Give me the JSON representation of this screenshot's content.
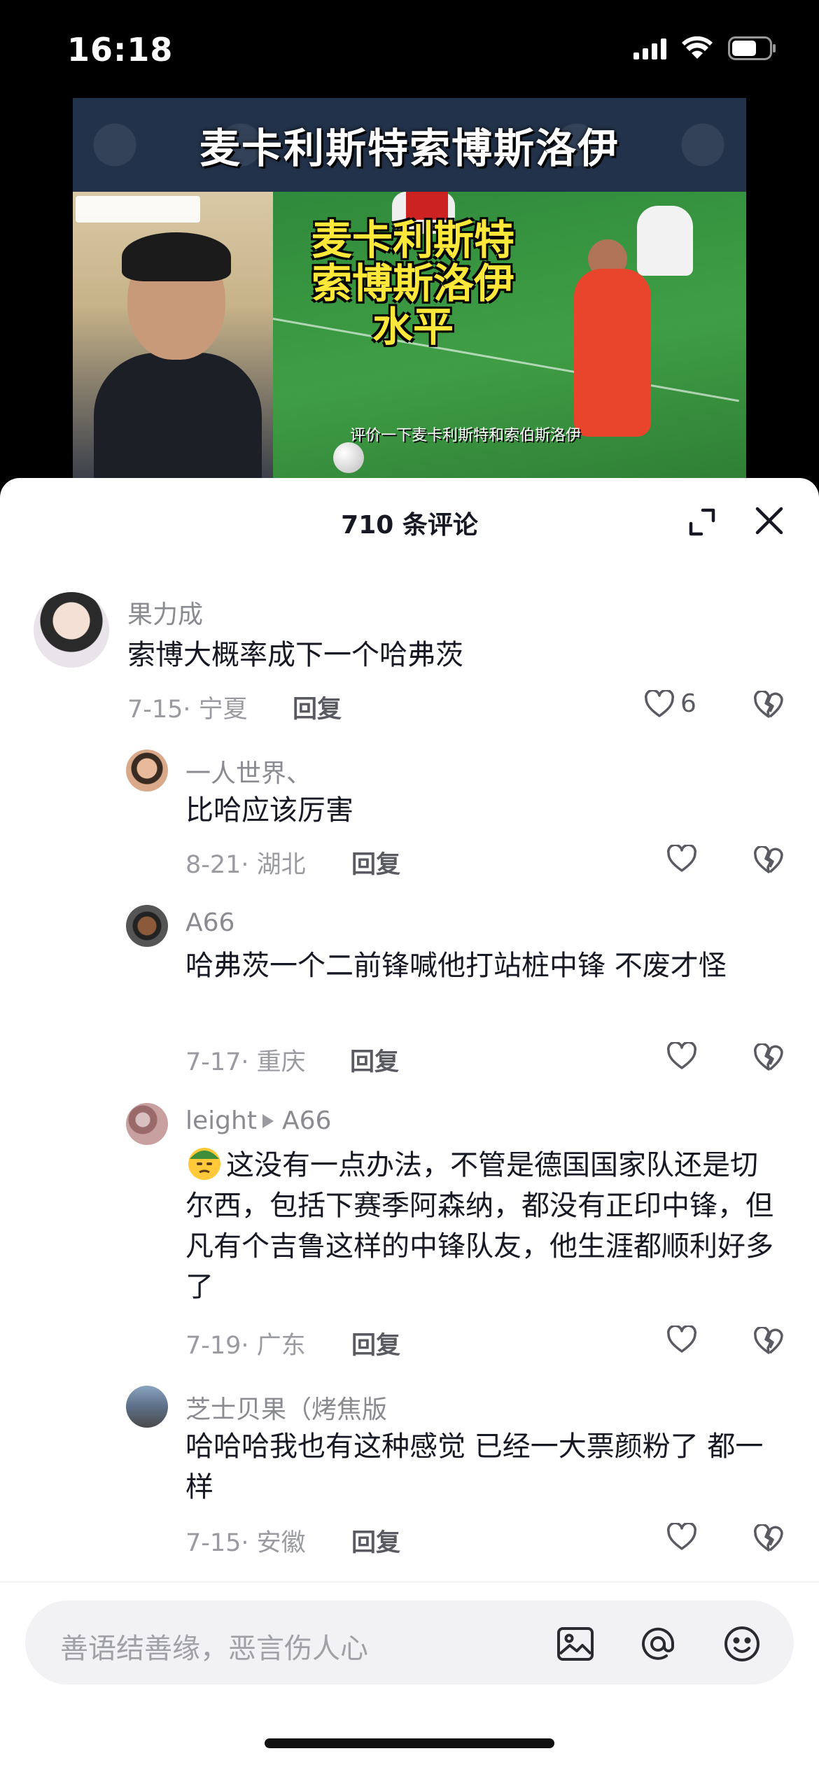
{
  "status_bar": {
    "time": "16:18"
  },
  "video": {
    "banner_title": "麦卡利斯特索博斯洛伊",
    "overlay_title_lines": [
      "麦卡利斯特",
      "索博斯洛伊",
      "水平"
    ],
    "subtitle": "评价一下麦卡利斯特和索伯斯洛伊"
  },
  "sheet": {
    "title": "710 条评论"
  },
  "comments": [
    {
      "name": "果力成",
      "text": "索博大概率成下一个哈弗茨",
      "meta": "7-15· 宁夏",
      "reply": "回复",
      "likes": "6"
    },
    {
      "name": "一人世界、",
      "text": "比哈应该厉害",
      "meta": "8-21· 湖北",
      "reply": "回复",
      "likes": ""
    },
    {
      "name": "A66",
      "text": "哈弗茨一个二前锋喊他打站桩中锋 不废才怪",
      "meta": "7-17· 重庆",
      "reply": "回复",
      "likes": ""
    },
    {
      "name": "leight",
      "reply_to": "A66",
      "text": "这没有一点办法，不管是德国国家队还是切尔西，包括下赛季阿森纳，都没有正印中锋，但凡有个吉鲁这样的中锋队友，他生涯都顺利好多了",
      "meta": "7-19· 广东",
      "reply": "回复",
      "likes": ""
    },
    {
      "name": "芝士贝果（烤焦版",
      "text": "哈哈哈我也有这种感觉 已经一大票颜粉了 都一样",
      "meta": "7-15· 安徽",
      "reply": "回复",
      "likes": ""
    }
  ],
  "input": {
    "placeholder": "善语结善缘，恶言伤人心"
  }
}
